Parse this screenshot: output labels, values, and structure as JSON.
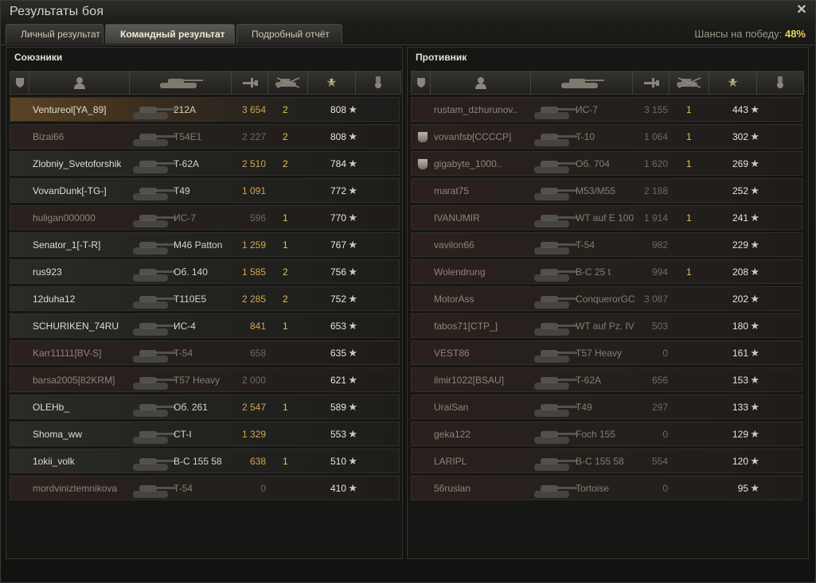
{
  "window": {
    "title": "Результаты боя",
    "close_icon": "close-icon"
  },
  "tabs": [
    {
      "label": "Личный результат",
      "active": false
    },
    {
      "label": "Командный результат",
      "active": true
    },
    {
      "label": "Подробный отчёт",
      "active": false
    }
  ],
  "win_chance": {
    "label": "Шансы на победу:",
    "value": "48%"
  },
  "allies": {
    "title": "Союзники",
    "header_icons": [
      "platoon-icon",
      "player-icon",
      "tank-icon",
      "damage-icon",
      "kills-icon",
      "xp-star-icon",
      "medal-icon"
    ],
    "rows": [
      {
        "name": "Ventureol[YA_89]",
        "tank": "212A",
        "damage": "3 654",
        "kills": "2",
        "xp": "808",
        "alive": true,
        "player": true,
        "platoon": false
      },
      {
        "name": "Bizai66",
        "tank": "T54E1",
        "damage": "2 227",
        "kills": "2",
        "xp": "808",
        "alive": false,
        "player": false,
        "platoon": false
      },
      {
        "name": "Zlobniy_Svetoforshik",
        "tank": "T-62A",
        "damage": "2 510",
        "kills": "2",
        "xp": "784",
        "alive": true,
        "player": false,
        "platoon": false
      },
      {
        "name": "VovanDunk[-TG-]",
        "tank": "T49",
        "damage": "1 091",
        "kills": "",
        "xp": "772",
        "alive": true,
        "player": false,
        "platoon": false
      },
      {
        "name": "huligan000000",
        "tank": "ИС-7",
        "damage": "596",
        "kills": "1",
        "xp": "770",
        "alive": false,
        "player": false,
        "platoon": false
      },
      {
        "name": "Senator_1[-T-R]",
        "tank": "M46 Patton",
        "damage": "1 259",
        "kills": "1",
        "xp": "767",
        "alive": true,
        "player": false,
        "platoon": false
      },
      {
        "name": "rus923",
        "tank": "Об. 140",
        "damage": "1 585",
        "kills": "2",
        "xp": "756",
        "alive": true,
        "player": false,
        "platoon": false
      },
      {
        "name": "12duha12",
        "tank": "T110E5",
        "damage": "2 285",
        "kills": "2",
        "xp": "752",
        "alive": true,
        "player": false,
        "platoon": false
      },
      {
        "name": "SCHURIKEN_74RU",
        "tank": "ИС-4",
        "damage": "841",
        "kills": "1",
        "xp": "653",
        "alive": true,
        "player": false,
        "platoon": false
      },
      {
        "name": "Karr11111[BV-S]",
        "tank": "T-54",
        "damage": "658",
        "kills": "",
        "xp": "635",
        "alive": false,
        "player": false,
        "platoon": false
      },
      {
        "name": "barsa2005[82KRM]",
        "tank": "T57 Heavy",
        "damage": "2 000",
        "kills": "",
        "xp": "621",
        "alive": false,
        "player": false,
        "platoon": false
      },
      {
        "name": "OLEHb_",
        "tank": "Об. 261",
        "damage": "2 547",
        "kills": "1",
        "xp": "589",
        "alive": true,
        "player": false,
        "platoon": false
      },
      {
        "name": "Shoma_ww",
        "tank": "CT-I",
        "damage": "1 329",
        "kills": "",
        "xp": "553",
        "alive": true,
        "player": false,
        "platoon": false
      },
      {
        "name": "1okii_volk",
        "tank": "B-C 155 58",
        "damage": "638",
        "kills": "1",
        "xp": "510",
        "alive": true,
        "player": false,
        "platoon": false
      },
      {
        "name": "mordviniztemnikova",
        "tank": "T-54",
        "damage": "0",
        "kills": "",
        "xp": "410",
        "alive": false,
        "player": false,
        "platoon": false
      }
    ]
  },
  "enemies": {
    "title": "Противник",
    "header_icons": [
      "platoon-icon",
      "player-icon",
      "tank-icon",
      "damage-icon",
      "kills-icon",
      "xp-star-icon",
      "medal-icon"
    ],
    "rows": [
      {
        "name": "rustam_dzhurunov..",
        "tank": "ИС-7",
        "damage": "3 155",
        "kills": "1",
        "xp": "443",
        "alive": false,
        "platoon": false
      },
      {
        "name": "vovanfsb[CCCCP]",
        "tank": "T-10",
        "damage": "1 064",
        "kills": "1",
        "xp": "302",
        "alive": false,
        "platoon": true
      },
      {
        "name": "gigabyte_1000..",
        "tank": "Об. 704",
        "damage": "1 620",
        "kills": "1",
        "xp": "269",
        "alive": false,
        "platoon": true
      },
      {
        "name": "marat75",
        "tank": "M53/M55",
        "damage": "2 188",
        "kills": "",
        "xp": "252",
        "alive": false,
        "platoon": false
      },
      {
        "name": "IVANUMIR",
        "tank": "WT auf E 100",
        "damage": "1 914",
        "kills": "1",
        "xp": "241",
        "alive": false,
        "platoon": false
      },
      {
        "name": "vavilon66",
        "tank": "T-54",
        "damage": "982",
        "kills": "",
        "xp": "229",
        "alive": false,
        "platoon": false
      },
      {
        "name": "Wolendrung",
        "tank": "B-C 25 t",
        "damage": "994",
        "kills": "1",
        "xp": "208",
        "alive": false,
        "platoon": false
      },
      {
        "name": "MotorAss",
        "tank": "ConquerorGC",
        "damage": "3 087",
        "kills": "",
        "xp": "202",
        "alive": false,
        "platoon": false
      },
      {
        "name": "fabos71[CTP_]",
        "tank": "WT auf Pz. IV",
        "damage": "503",
        "kills": "",
        "xp": "180",
        "alive": false,
        "platoon": false
      },
      {
        "name": "VEST86",
        "tank": "T57 Heavy",
        "damage": "0",
        "kills": "",
        "xp": "161",
        "alive": false,
        "platoon": false
      },
      {
        "name": "ilmir1022[BSAU]",
        "tank": "T-62A",
        "damage": "656",
        "kills": "",
        "xp": "153",
        "alive": false,
        "platoon": false
      },
      {
        "name": "UraiSan",
        "tank": "T49",
        "damage": "297",
        "kills": "",
        "xp": "133",
        "alive": false,
        "platoon": false
      },
      {
        "name": "geka122",
        "tank": "Foch 155",
        "damage": "0",
        "kills": "",
        "xp": "129",
        "alive": false,
        "platoon": false
      },
      {
        "name": "LARIPL",
        "tank": "B-C 155 58",
        "damage": "554",
        "kills": "",
        "xp": "120",
        "alive": false,
        "platoon": false
      },
      {
        "name": "56ruslan",
        "tank": "Tortoise",
        "damage": "0",
        "kills": "",
        "xp": "95",
        "alive": false,
        "platoon": false
      }
    ]
  },
  "colors": {
    "win_chance": "#e8d45a",
    "damage": "#d6a64e",
    "kills": "#e4c05a",
    "player_row": "#5b4325",
    "dead_row": "#2b201e"
  }
}
